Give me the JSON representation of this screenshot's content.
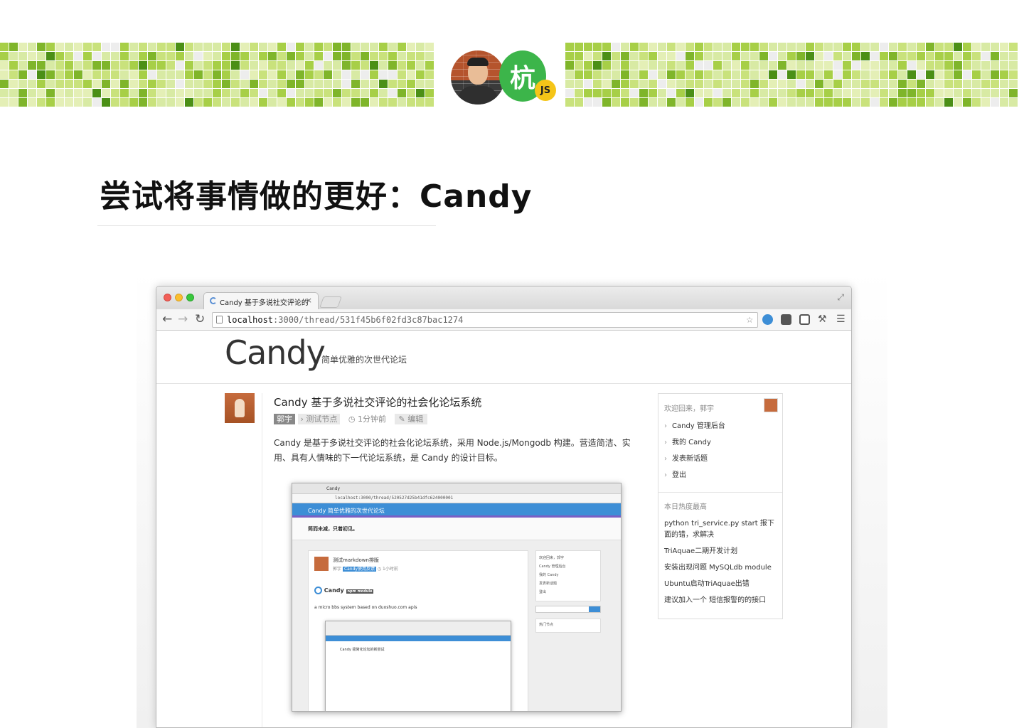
{
  "banner": {
    "badge_char": "杭",
    "badge_sub": "JS"
  },
  "slide": {
    "title": "尝试将事情做的更好：Candy"
  },
  "browser": {
    "tab_title": "Candy 基于多说社交评论的",
    "tab_close": "×",
    "url_host": "localhost",
    "url_path": ":3000/thread/531f45b6f02fd3c87bac1274",
    "icons": [
      "back-arrow-icon",
      "forward-arrow-icon",
      "reload-icon",
      "star-icon",
      "extension-icon",
      "pocket-icon",
      "image-icon",
      "wrench-icon",
      "menu-icon"
    ]
  },
  "site": {
    "logo": "Candy",
    "slogan": "简单优雅的次世代论坛"
  },
  "post": {
    "title": "Candy 基于多说社交评论的社会化论坛系统",
    "author": "郭宇",
    "node": "测试节点",
    "time": "1分钟前",
    "edit": "编辑",
    "body": "Candy 是基于多说社交评论的社会化论坛系统，采用 Node.js/Mongodb 构建。营造简洁、实用、具有人情味的下一代论坛系统，是 Candy 的设计目标。"
  },
  "nested": {
    "tab": "Candy",
    "url": "localhost:3000/thread/520527d25b41dfc624000001",
    "brand": "Candy 简单优雅的次世代论坛",
    "motto": "简而未减，只着初见。",
    "thread_title": "测试markdown排版",
    "thread_author": "郭宇",
    "thread_node": "Candy使用反馈",
    "thread_time": "1小时前",
    "readme_title": "Candy",
    "readme_badge": "npm module",
    "readme_text": "a micro bbs system based on duoshuo.com apis",
    "side_welcome": "欢迎回来，郭宇",
    "side_items": [
      "Candy 管理后台",
      "我的 Candy",
      "发表新话题",
      "登出"
    ],
    "hot_nodes": "热门节点",
    "inner_title": "Candy 极简化论坛的新尝试"
  },
  "sidebar": {
    "welcome": "欢迎回来，郭宇",
    "items": [
      "Candy 管理后台",
      "我的 Candy",
      "发表新话题",
      "登出"
    ],
    "hot_title": "本日热度最高",
    "hot_items": [
      "python tri_service.py start 报下面的错，求解决",
      "TriAquae二期开发计划",
      "安装出现问题 MySQLdb module",
      "Ubuntu启动TriAquae出错",
      "建议加入一个 短信报警的的接口"
    ]
  },
  "colors": {
    "badge_green": "#3cb54a",
    "js_yellow": "#f5c518",
    "candy_blue": "#3d8ed6"
  }
}
